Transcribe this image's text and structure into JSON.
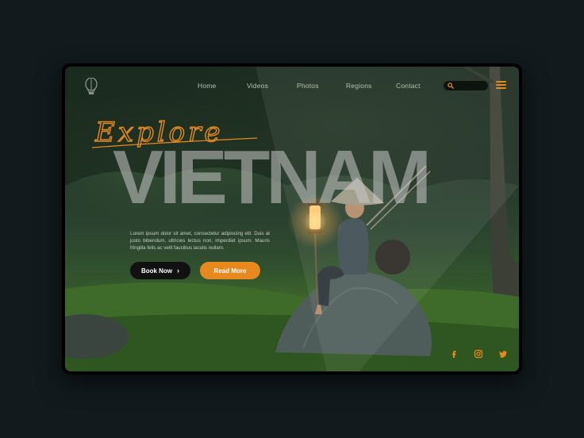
{
  "nav": {
    "items": [
      "Home",
      "Videos",
      "Photos",
      "Regions",
      "Contact"
    ]
  },
  "hero": {
    "script_title": "Explore",
    "title": "VIETNAM",
    "description": "Lorem ipsum dolor sit amet, consectetur adipiscing elit. Duis at justo bibendum, ultricies lectus non, imperdiet ipsum. Mauris fringilla felis ac velit faucibus iaculis nullam.",
    "book_label": "Book Now",
    "read_label": "Read More"
  },
  "social": [
    "facebook-icon",
    "instagram-icon",
    "twitter-icon"
  ],
  "colors": {
    "accent": "#e8891f",
    "background": "#121a1d"
  }
}
